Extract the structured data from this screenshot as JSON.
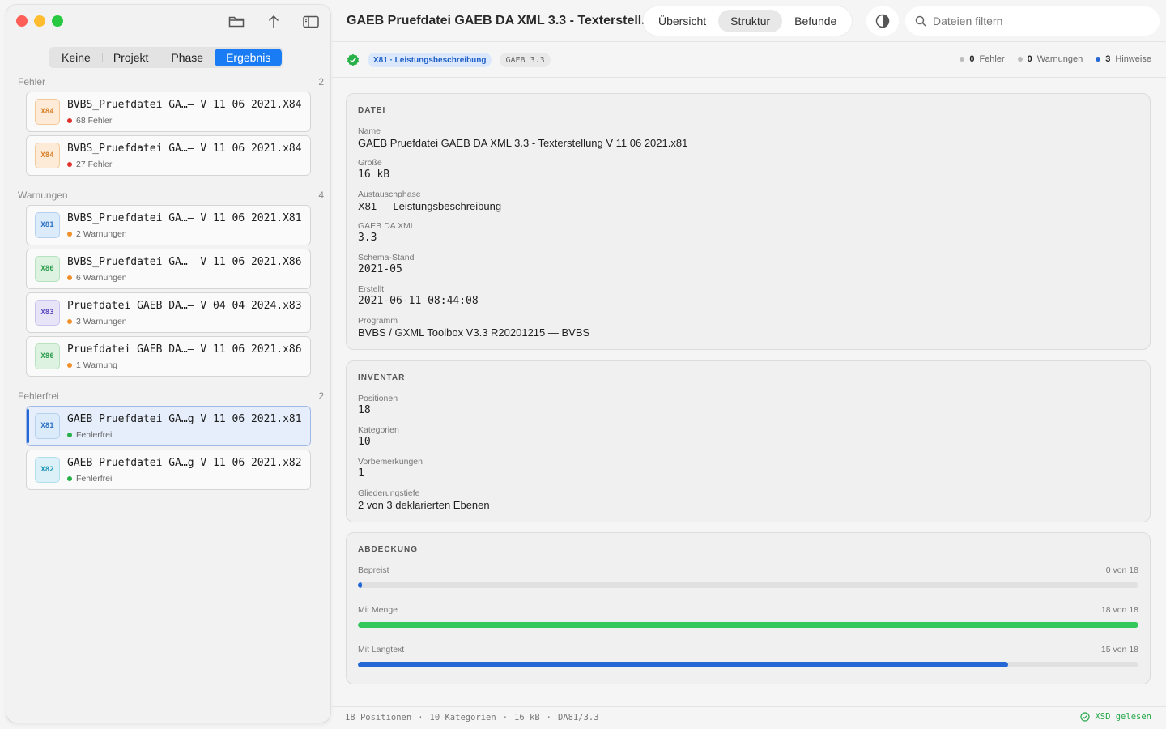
{
  "sidebar": {
    "filter_tabs": [
      "Keine",
      "Projekt",
      "Phase",
      "Ergebnis"
    ],
    "active_filter": "Ergebnis",
    "groups": [
      {
        "title": "Fehler",
        "count": "2",
        "files": [
          {
            "badge": "X84",
            "color": "orange",
            "name": "BVBS_Pruefdatei GA…– V 11 06 2021.X84",
            "status": "68 Fehler",
            "dot": "red"
          },
          {
            "badge": "X84",
            "color": "orange",
            "name": "BVBS_Pruefdatei GA…– V 11 06 2021.x84",
            "status": "27 Fehler",
            "dot": "red"
          }
        ]
      },
      {
        "title": "Warnungen",
        "count": "4",
        "files": [
          {
            "badge": "X81",
            "color": "blue",
            "name": "BVBS_Pruefdatei GA…– V 11 06 2021.X81",
            "status": "2 Warnungen",
            "dot": "orange"
          },
          {
            "badge": "X86",
            "color": "green",
            "name": "BVBS_Pruefdatei GA…– V 11 06 2021.X86",
            "status": "6 Warnungen",
            "dot": "orange"
          },
          {
            "badge": "X83",
            "color": "purple",
            "name": "Pruefdatei GAEB DA…– V 04 04 2024.x83",
            "status": "3 Warnungen",
            "dot": "orange"
          },
          {
            "badge": "X86",
            "color": "green",
            "name": "Pruefdatei GAEB DA…– V 11 06 2021.x86",
            "status": "1 Warnung",
            "dot": "orange"
          }
        ]
      },
      {
        "title": "Fehlerfrei",
        "count": "2",
        "files": [
          {
            "badge": "X81",
            "color": "blue",
            "name": "GAEB Pruefdatei GA…g V 11 06 2021.x81",
            "status": "Fehlerfrei",
            "dot": "green",
            "selected": true
          },
          {
            "badge": "X82",
            "color": "cyan",
            "name": "GAEB Pruefdatei GA…g V 11 06 2021.x82",
            "status": "Fehlerfrei",
            "dot": "green"
          }
        ]
      }
    ]
  },
  "header": {
    "title": "GAEB Pruefdatei GAEB DA XML 3.3 - Texterstell...",
    "tabs": [
      "Übersicht",
      "Struktur",
      "Befunde"
    ],
    "active_tab": "Struktur",
    "search_placeholder": "Dateien filtern"
  },
  "status": {
    "chip_phase": "X81 · Leistungsbeschreibung",
    "chip_version": "GAEB 3.3",
    "fehler_count": "0",
    "fehler_label": "Fehler",
    "warnungen_count": "0",
    "warnungen_label": "Warnungen",
    "hinweise_count": "3",
    "hinweise_label": "Hinweise"
  },
  "datei": {
    "heading": "DATEI",
    "fields": [
      {
        "label": "Name",
        "value": "GAEB Pruefdatei GAEB DA XML 3.3 - Texterstellung V 11 06 2021.x81",
        "mono": false
      },
      {
        "label": "Größe",
        "value": "16 kB",
        "mono": true
      },
      {
        "label": "Austauschphase",
        "value": "X81 — Leistungsbeschreibung",
        "mono": false
      },
      {
        "label": "GAEB DA XML",
        "value": "3.3",
        "mono": true
      },
      {
        "label": "Schema-Stand",
        "value": "2021-05",
        "mono": true
      },
      {
        "label": "Erstellt",
        "value": "2021-06-11 08:44:08",
        "mono": true
      },
      {
        "label": "Programm",
        "value": "BVBS / GXML Toolbox V3.3 R20201215 — BVBS",
        "mono": false
      }
    ]
  },
  "inventar": {
    "heading": "INVENTAR",
    "fields": [
      {
        "label": "Positionen",
        "value": "18",
        "mono": true
      },
      {
        "label": "Kategorien",
        "value": "10",
        "mono": true
      },
      {
        "label": "Vorbemerkungen",
        "value": "1",
        "mono": true
      },
      {
        "label": "Gliederungstiefe",
        "value": "2 von 3 deklarierten Ebenen",
        "mono": false
      }
    ]
  },
  "abdeckung": {
    "heading": "ABDECKUNG",
    "bars": [
      {
        "label": "Bepreist",
        "count": "0 von 18",
        "fraction": 0.0,
        "color": "#2468d6"
      },
      {
        "label": "Mit Menge",
        "count": "18 von 18",
        "fraction": 1.0,
        "color": "#34c759"
      },
      {
        "label": "Mit Langtext",
        "count": "15 von 18",
        "fraction": 0.8333,
        "color": "#2468d6"
      }
    ]
  },
  "footer": {
    "items": [
      "18 Positionen",
      "·",
      "10 Kategorien",
      "·",
      "16 kB",
      "·",
      "DA81/3.3"
    ],
    "right": "XSD gelesen"
  }
}
